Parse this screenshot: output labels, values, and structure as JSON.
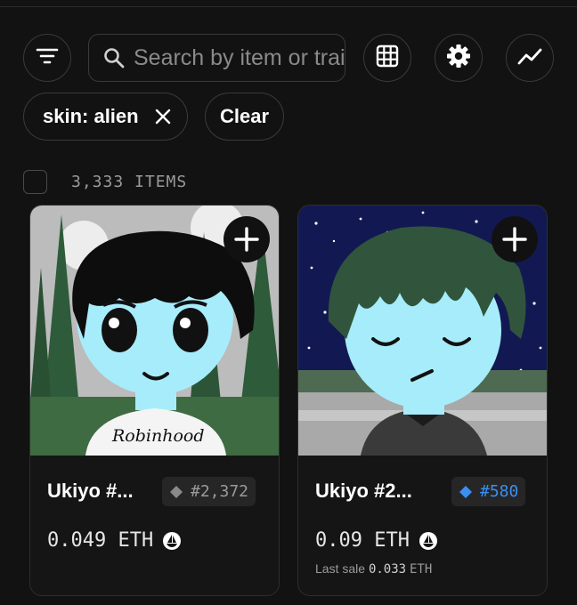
{
  "toolbar": {
    "filter_icon": "filter-lines-icon",
    "search_placeholder": "Search by item or trait",
    "search_icon": "search-icon",
    "grid_icon": "grid-view-icon",
    "settings_icon": "gear-icon",
    "activity_icon": "trend-line-icon"
  },
  "filters": {
    "active_chip_label": "skin: alien",
    "clear_label": "Clear"
  },
  "results": {
    "count_label": "3,333 ITEMS"
  },
  "colors": {
    "background": "#121212",
    "rarity_gray": "#8a8a8a",
    "rarity_blue": "#3b8ff3",
    "skin_alien": "#a7ecfb"
  },
  "items": [
    {
      "name": "Ukiyo #...",
      "rank": "#2,372",
      "rank_tier": "gray",
      "price": "0.049",
      "currency": "ETH",
      "shirt_text": "Robinhood",
      "last_sale_label": "",
      "last_sale_value": "",
      "last_sale_currency": ""
    },
    {
      "name": "Ukiyo #2...",
      "rank": "#580",
      "rank_tier": "blue",
      "price": "0.09",
      "currency": "ETH",
      "shirt_text": "",
      "last_sale_label": "Last sale",
      "last_sale_value": "0.033",
      "last_sale_currency": "ETH"
    }
  ]
}
